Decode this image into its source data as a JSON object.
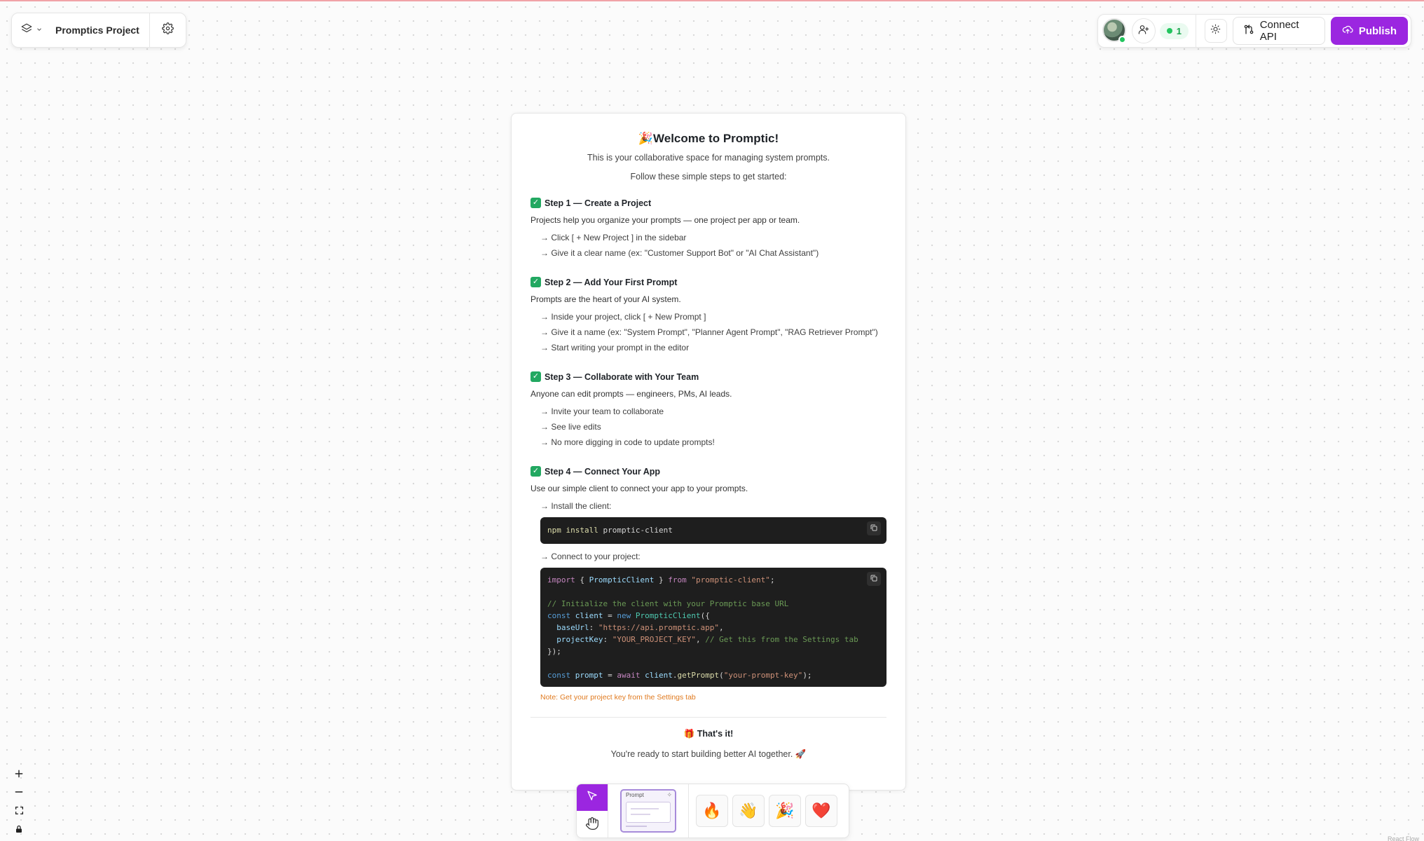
{
  "header": {
    "project_name": "Promptics Project",
    "online_count": "1",
    "connect_label": "Connect API",
    "publish_label": "Publish"
  },
  "welcome": {
    "title": "Welcome to Promptic!",
    "subtitle": "This is your collaborative space for managing system prompts.",
    "subtitle2": "Follow these simple steps to get started:",
    "steps": [
      {
        "heading": "Step 1 — Create a Project",
        "desc": "Projects help you organize your prompts — one project per app or team.",
        "bullets": [
          "→ Click [ + New Project ] in the sidebar",
          "→ Give it a clear name (ex: \"Customer Support Bot\" or \"AI Chat Assistant\")"
        ]
      },
      {
        "heading": "Step 2 — Add Your First Prompt",
        "desc": "Prompts are the heart of your AI system.",
        "bullets": [
          "→ Inside your project, click [ + New Prompt ]",
          "→ Give it a name (ex: \"System Prompt\", \"Planner Agent Prompt\", \"RAG Retriever Prompt\")",
          "→ Start writing your prompt in the editor"
        ]
      },
      {
        "heading": "Step 3 — Collaborate with Your Team",
        "desc": "Anyone can edit prompts — engineers, PMs, AI leads.",
        "bullets": [
          "→ Invite your team to collaborate",
          "→ See live edits",
          "→ No more digging in code to update prompts!"
        ]
      },
      {
        "heading": "Step 4 — Connect Your App",
        "desc": "Use our simple client to connect your app to your prompts.",
        "install_label": "→ Install the client:",
        "connect_label": "→ Connect to your project:"
      }
    ],
    "install_cmd": {
      "npm": "npm",
      "install": "install",
      "pkg": "promptic-client"
    },
    "code": {
      "l1_import": "import",
      "l1_brace_open": " { ",
      "l1_cls": "PrompticClient",
      "l1_brace_close": " } ",
      "l1_from": "from",
      "l1_str": "\"promptic-client\"",
      "l1_end": ";",
      "l2_comment": "// Initialize the client with your Promptic base URL",
      "l3_const": "const",
      "l3_var": "client",
      "l3_eq": " = ",
      "l3_new": "new",
      "l3_cls": "PrompticClient",
      "l3_end": "({",
      "l4_key": "  baseUrl",
      "l4_colon": ": ",
      "l4_str": "\"https://api.promptic.app\"",
      "l4_end": ",",
      "l5_key": "  projectKey",
      "l5_colon": ": ",
      "l5_str": "\"YOUR_PROJECT_KEY\"",
      "l5_comma": ", ",
      "l5_comment": "// Get this from the Settings tab",
      "l6": "});",
      "l7_const": "const",
      "l7_var": "prompt",
      "l7_eq": " = ",
      "l7_await": "await",
      "l7_obj": " client",
      "l7_dot": ".",
      "l7_fn": "getPrompt",
      "l7_open": "(",
      "l7_str": "\"your-prompt-key\"",
      "l7_end": ");"
    },
    "note": "Note: Get your project key from the Settings tab",
    "done_title": "That's it!",
    "done_sub": "You're ready to start building better AI together."
  },
  "toolbar": {
    "prompt_tile_label": "Prompt",
    "reactions": [
      "🔥",
      "👋",
      "🎉",
      "❤️"
    ]
  },
  "corner_text": "React Flow"
}
